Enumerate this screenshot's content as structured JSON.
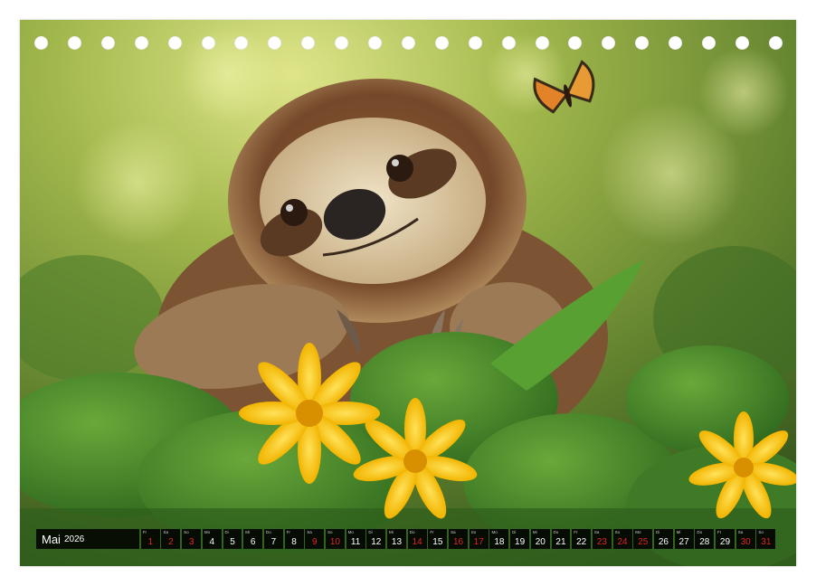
{
  "calendar": {
    "month": "Mai",
    "year": "2026",
    "red_color": "#e0252b",
    "days": [
      {
        "n": "1",
        "wd": "Fr",
        "red": true
      },
      {
        "n": "2",
        "wd": "Sa",
        "red": true
      },
      {
        "n": "3",
        "wd": "So",
        "red": true
      },
      {
        "n": "4",
        "wd": "Mo",
        "red": false
      },
      {
        "n": "5",
        "wd": "Di",
        "red": false
      },
      {
        "n": "6",
        "wd": "Mi",
        "red": false
      },
      {
        "n": "7",
        "wd": "Do",
        "red": false
      },
      {
        "n": "8",
        "wd": "Fr",
        "red": false
      },
      {
        "n": "9",
        "wd": "Sa",
        "red": true
      },
      {
        "n": "10",
        "wd": "So",
        "red": true
      },
      {
        "n": "11",
        "wd": "Mo",
        "red": false
      },
      {
        "n": "12",
        "wd": "Di",
        "red": false
      },
      {
        "n": "13",
        "wd": "Mi",
        "red": false
      },
      {
        "n": "14",
        "wd": "Do",
        "red": true
      },
      {
        "n": "15",
        "wd": "Fr",
        "red": false
      },
      {
        "n": "16",
        "wd": "Sa",
        "red": true
      },
      {
        "n": "17",
        "wd": "So",
        "red": true
      },
      {
        "n": "18",
        "wd": "Mo",
        "red": false
      },
      {
        "n": "19",
        "wd": "Di",
        "red": false
      },
      {
        "n": "20",
        "wd": "Mi",
        "red": false
      },
      {
        "n": "21",
        "wd": "Do",
        "red": false
      },
      {
        "n": "22",
        "wd": "Fr",
        "red": false
      },
      {
        "n": "23",
        "wd": "Sa",
        "red": true
      },
      {
        "n": "24",
        "wd": "So",
        "red": true
      },
      {
        "n": "25",
        "wd": "Mo",
        "red": true
      },
      {
        "n": "26",
        "wd": "Di",
        "red": false
      },
      {
        "n": "27",
        "wd": "Mi",
        "red": false
      },
      {
        "n": "28",
        "wd": "Do",
        "red": false
      },
      {
        "n": "29",
        "wd": "Fr",
        "red": false
      },
      {
        "n": "30",
        "wd": "Sa",
        "red": true
      },
      {
        "n": "31",
        "wd": "So",
        "red": true
      }
    ]
  }
}
